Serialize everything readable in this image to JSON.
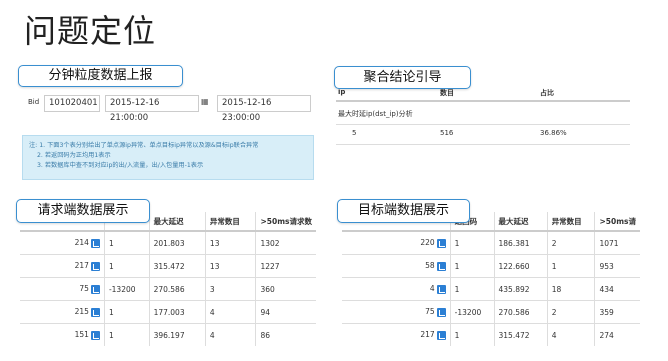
{
  "page_title": "问题定位",
  "sections": {
    "upload": "分钟粒度数据上报",
    "conclusion": "聚合结论引导",
    "request": "请求端数据展示",
    "target": "目标端数据展示"
  },
  "filter": {
    "bid_label": "Bid",
    "bid_value": "101020401",
    "start_time": "2015-12-16 21:00:00",
    "end_time": "2015-12-16 23:00:00",
    "note_lines": [
      "注: 1. 下面3个表分别给出了单点源ip异常、单点目标ip异常以及源&目标ip联合异常",
      "2. 若返回码为正均用1表示",
      "3. 若数据库中查不到对应ip的出/入流量，出/入包量用-1表示"
    ]
  },
  "conclusion": {
    "headers": [
      "ip",
      "数目",
      "占比"
    ],
    "subtitle": "最大时延ip(dst_ip)分析",
    "row": {
      "ip": "5",
      "count": "516",
      "ratio": "36.86%"
    }
  },
  "request_table": {
    "headers": [
      "",
      "",
      "最大延迟",
      "异常数目",
      ">50ms请求数"
    ],
    "rows": [
      {
        "id": "214",
        "code": "1",
        "max": "201.803",
        "abn": "13",
        "req": "1302"
      },
      {
        "id": "217",
        "code": "1",
        "max": "315.472",
        "abn": "13",
        "req": "1227"
      },
      {
        "id": "75",
        "code": "-13200",
        "max": "270.586",
        "abn": "3",
        "req": "360"
      },
      {
        "id": "215",
        "code": "1",
        "max": "177.003",
        "abn": "4",
        "req": "94"
      },
      {
        "id": "151",
        "code": "1",
        "max": "396.197",
        "abn": "4",
        "req": "86"
      }
    ]
  },
  "target_table": {
    "headers": [
      "",
      "返回码",
      "最大延迟",
      "异常数目",
      ">50ms请"
    ],
    "rows": [
      {
        "id": "220",
        "code": "1",
        "max": "186.381",
        "abn": "2",
        "req": "1071"
      },
      {
        "id": "58",
        "code": "1",
        "max": "122.660",
        "abn": "1",
        "req": "953"
      },
      {
        "id": "4",
        "code": "1",
        "max": "435.892",
        "abn": "18",
        "req": "434"
      },
      {
        "id": "75",
        "code": "-13200",
        "max": "270.586",
        "abn": "2",
        "req": "359"
      },
      {
        "id": "217",
        "code": "1",
        "max": "315.472",
        "abn": "4",
        "req": "274"
      }
    ]
  }
}
